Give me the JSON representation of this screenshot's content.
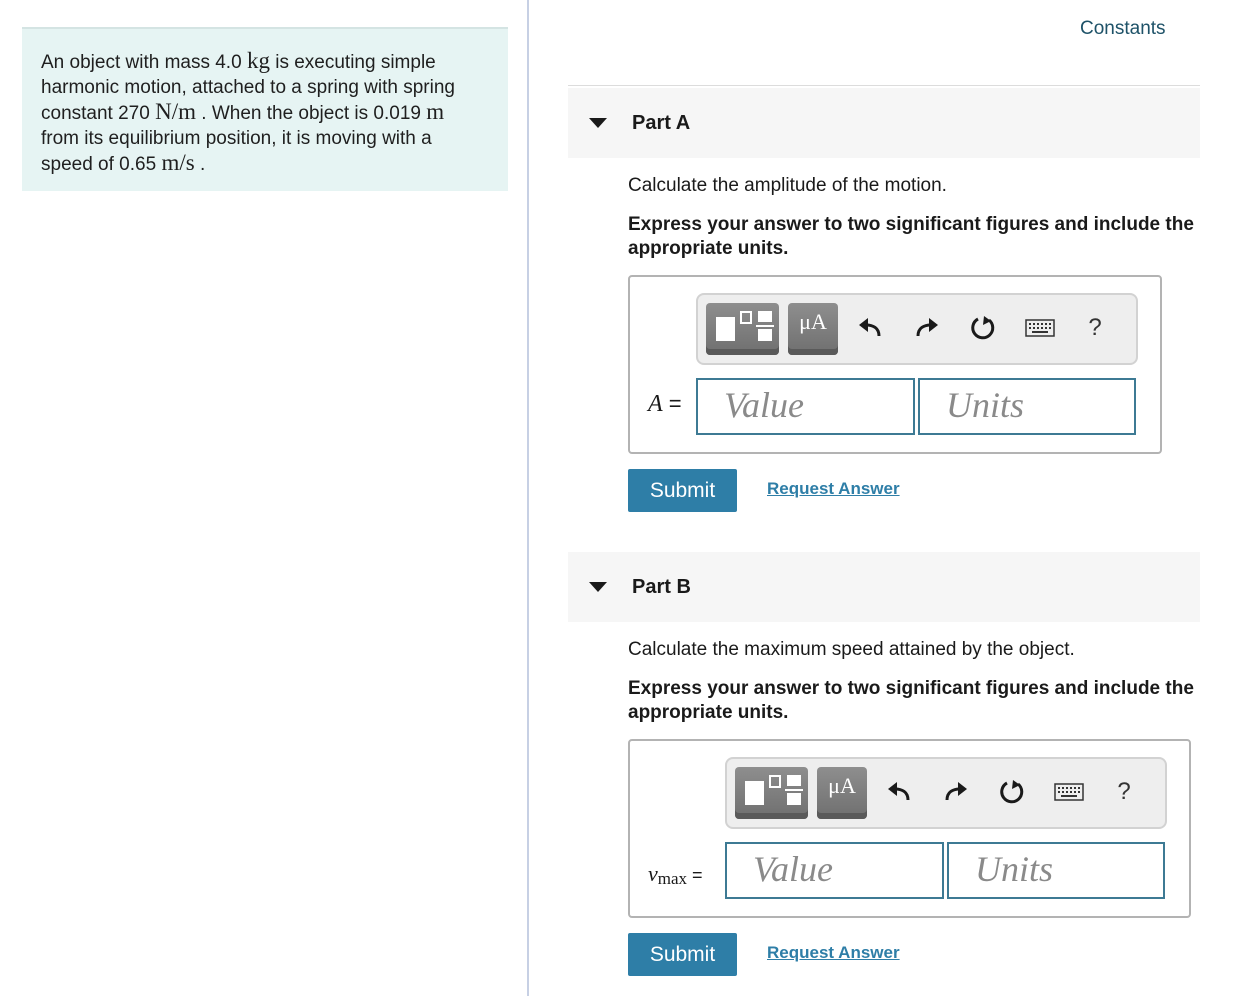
{
  "problem": {
    "line1_a": "An object with mass 4.0 ",
    "line1_unit": "kg",
    "line1_b": " is executing simple",
    "line2": "harmonic motion, attached to a spring with spring",
    "line3_a": "constant 270 ",
    "line3_unit": "N/m",
    "line3_b": " . When the object is 0.019 ",
    "line3_unit2": "m",
    "line4": "from its equilibrium position, it is moving with a",
    "line5_a": "speed of 0.65 ",
    "line5_unit": "m/s",
    "line5_b": " ."
  },
  "constants_link": "Constants",
  "partA": {
    "title": "Part A",
    "question": "Calculate the amplitude of the motion.",
    "instruction": "Express your answer to two significant figures and include the appropriate units.",
    "var_symbol": "A",
    "var_eq": " =",
    "value_placeholder": "Value",
    "units_placeholder": "Units",
    "mu_label": "μA",
    "help": "?",
    "submit": "Submit",
    "request": "Request Answer"
  },
  "partB": {
    "title": "Part B",
    "question": "Calculate the maximum speed attained by the object.",
    "instruction": "Express your answer to two significant figures and include the appropriate units.",
    "var_symbol": "v",
    "var_sub": "max",
    "var_eq": " =",
    "value_placeholder": "Value",
    "units_placeholder": "Units",
    "mu_label": "μA",
    "help": "?",
    "submit": "Submit",
    "request": "Request Answer"
  },
  "icons": [
    "templates-icon",
    "symbols-icon",
    "undo-icon",
    "redo-icon",
    "reset-icon",
    "keyboard-icon",
    "help-icon",
    "collapse-triangle-icon"
  ]
}
